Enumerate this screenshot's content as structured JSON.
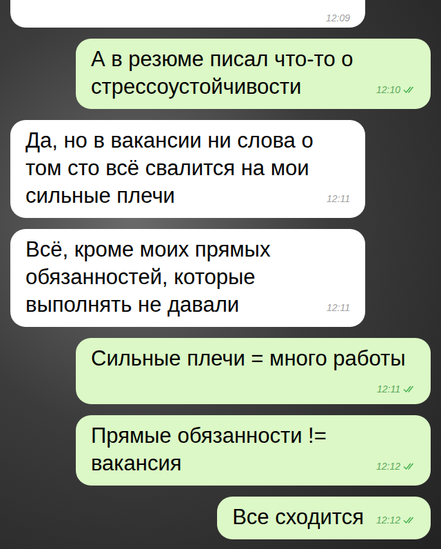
{
  "messages": [
    {
      "kind": "incoming",
      "text": "",
      "time": "12:09"
    },
    {
      "kind": "outgoing",
      "text": "А в резюме писал что-то о стрессоустойчивости",
      "time": "12:10",
      "read": true
    },
    {
      "kind": "incoming",
      "text": "Да, но в вакансии ни слова о том сто всё свалится на мои сильные плечи",
      "time": "12:11"
    },
    {
      "kind": "incoming",
      "text": "Всё, кроме моих прямых обязанностей, которые выполнять не давали",
      "time": "12:11"
    },
    {
      "kind": "outgoing",
      "text": "Сильные плечи = много работы",
      "time": "12:11",
      "read": true
    },
    {
      "kind": "outgoing",
      "text": "Прямые обязанности != вакансия",
      "time": "12:12",
      "read": true
    },
    {
      "kind": "outgoing",
      "text": "Все сходится",
      "time": "12:12",
      "read": true
    }
  ]
}
